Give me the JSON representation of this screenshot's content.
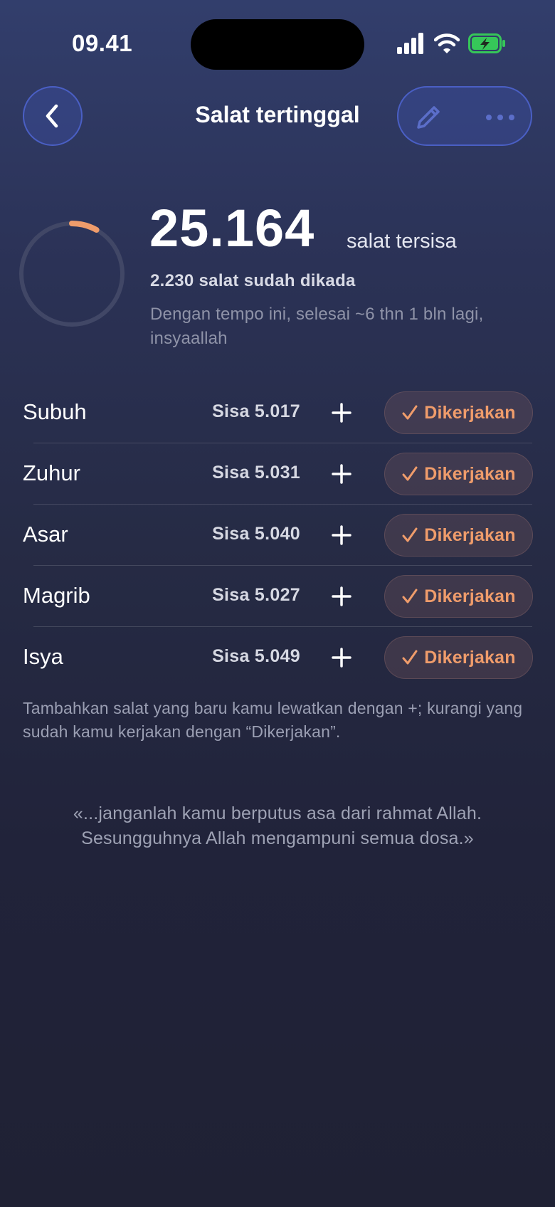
{
  "status_bar": {
    "time": "09.41",
    "icons": [
      "signal-icon",
      "wifi-icon",
      "battery-charging-icon"
    ]
  },
  "nav": {
    "title": "Salat tertinggal",
    "back_icon": "chevron-left-icon",
    "edit_icon": "pencil-icon",
    "more_icon": "more-horizontal-icon"
  },
  "summary": {
    "remaining_count": "25.164",
    "remaining_unit": "salat tersisa",
    "done_text": "2.230 salat sudah dikada",
    "eta_text": "Dengan tempo ini, selesai ~6 thn 1 bln lagi, insyaallah",
    "progress_fraction": 0.081
  },
  "prayers": [
    {
      "name": "Subuh",
      "remaining": "Sisa 5.017",
      "action_label": "Dikerjakan"
    },
    {
      "name": "Zuhur",
      "remaining": "Sisa 5.031",
      "action_label": "Dikerjakan"
    },
    {
      "name": "Asar",
      "remaining": "Sisa 5.040",
      "action_label": "Dikerjakan"
    },
    {
      "name": "Magrib",
      "remaining": "Sisa 5.027",
      "action_label": "Dikerjakan"
    },
    {
      "name": "Isya",
      "remaining": "Sisa 5.049",
      "action_label": "Dikerjakan"
    }
  ],
  "hint": "Tambahkan salat yang baru kamu lewatkan dengan +; kurangi yang sudah kamu kerjakan dengan “Dikerjakan”.",
  "quote": "«...janganlah kamu berputus asa dari rahmat Allah. Sesungguhnya Allah mengampuni semua dosa.»",
  "colors": {
    "accent": "#ef9c6b",
    "nav_button_border": "#4a5fc4",
    "battery_charging": "#36c759"
  }
}
